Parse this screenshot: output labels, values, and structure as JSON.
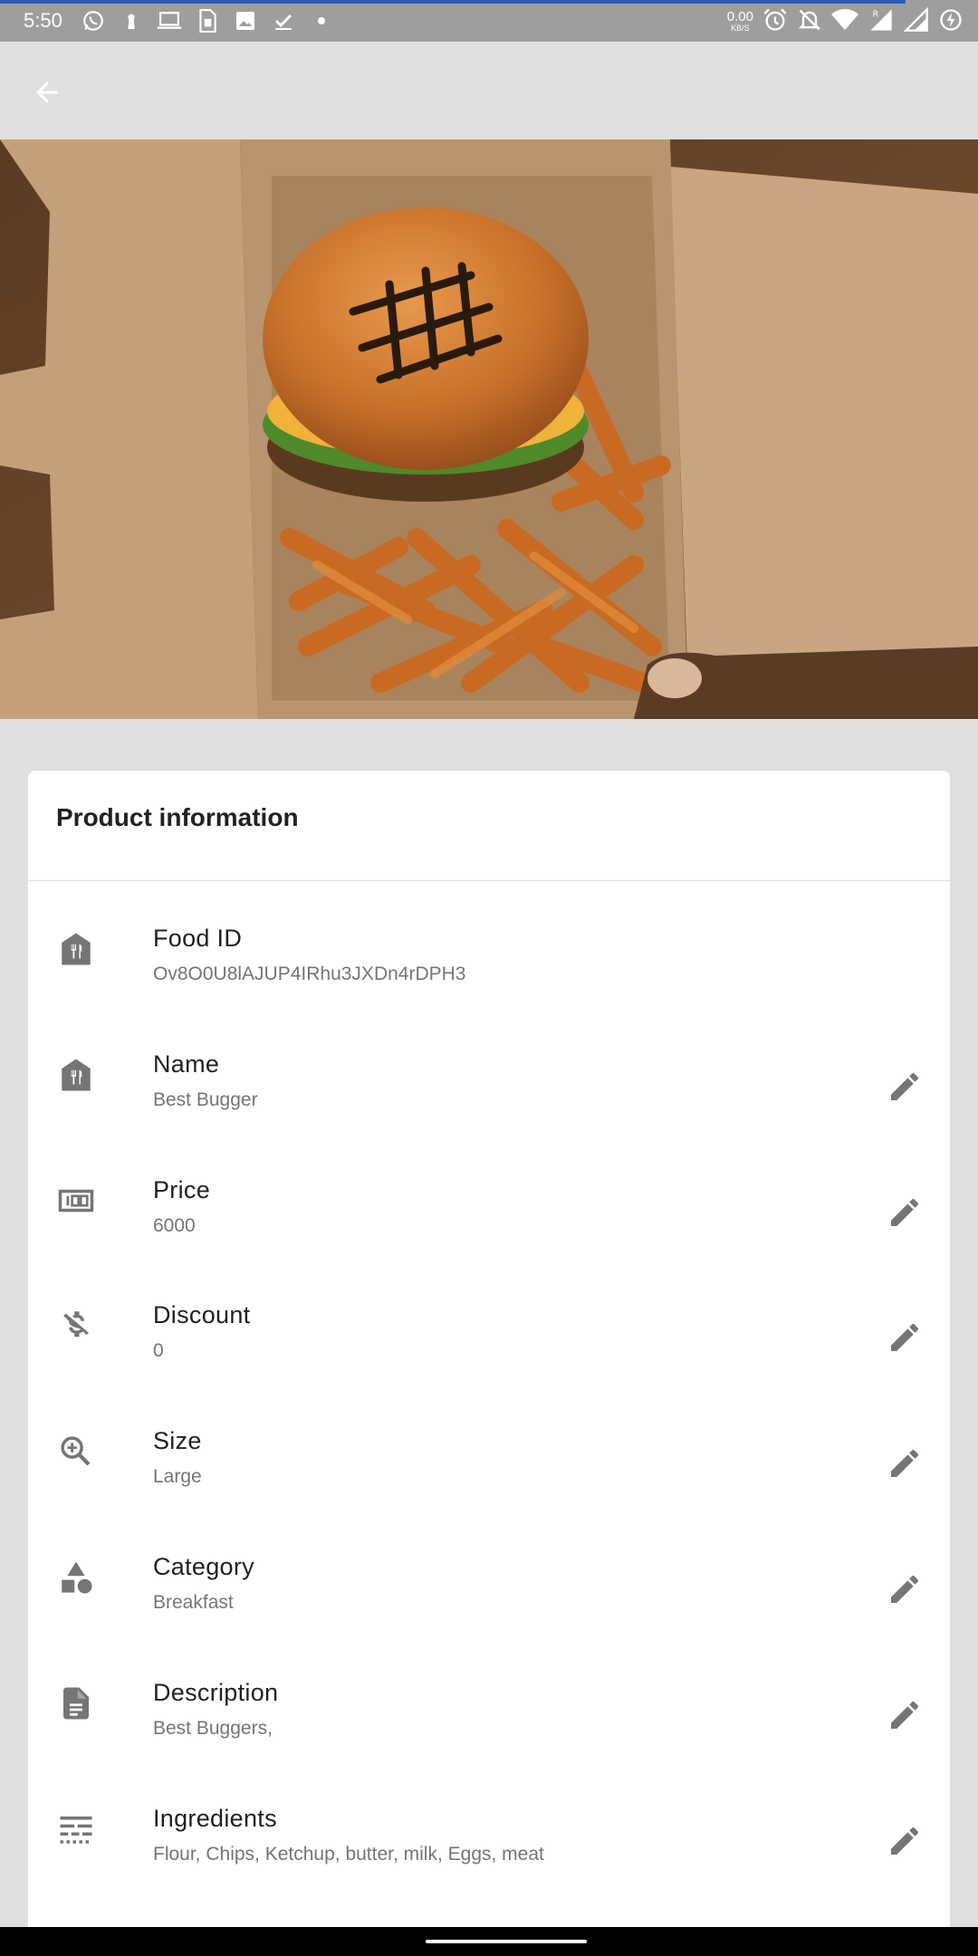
{
  "status_bar": {
    "time": "5:50",
    "net_speed_value": "0.00",
    "net_speed_unit": "KB/S",
    "icons_left": [
      "whatsapp-icon",
      "keyhole-icon",
      "laptop-icon",
      "sim-card-icon",
      "image-icon",
      "download-done-icon",
      "dot-icon"
    ],
    "icons_right": [
      "alarm-icon",
      "notifications-off-icon",
      "wifi-icon",
      "signal-roaming-icon",
      "signal-icon",
      "battery-saver-icon"
    ]
  },
  "app_bar": {
    "back_icon": "arrow-back-icon"
  },
  "hero": {
    "icon": "burger-fries-image"
  },
  "card": {
    "title": "Product information",
    "rows": [
      {
        "label": "Food ID",
        "value": "Ov8O0U8lAJUP4IRhu3JXDn4rDPH3",
        "icon": "restaurant-store-icon",
        "editable": false
      },
      {
        "label": "Name",
        "value": "Best Bugger",
        "icon": "restaurant-store-icon",
        "editable": true
      },
      {
        "label": "Price",
        "value": "6000",
        "icon": "money-100-icon",
        "editable": true
      },
      {
        "label": "Discount",
        "value": "0",
        "icon": "money-off-icon",
        "editable": true
      },
      {
        "label": "Size",
        "value": "Large",
        "icon": "zoom-in-icon",
        "editable": true
      },
      {
        "label": "Category",
        "value": "Breakfast",
        "icon": "category-shapes-icon",
        "editable": true
      },
      {
        "label": "Description",
        "value": "Best Buggers,",
        "icon": "description-icon",
        "editable": true
      },
      {
        "label": "Ingredients",
        "value": "Flour, Chips, Ketchup, butter, milk, Eggs, meat",
        "icon": "ingredients-list-icon",
        "editable": true
      }
    ]
  },
  "colors": {
    "status_bar": "#9e9e9e",
    "progress": "#2f5bb7",
    "app_bar": "#e0e0e0",
    "card": "#ffffff",
    "label": "#212121",
    "value": "#757575",
    "icon": "#757575"
  }
}
